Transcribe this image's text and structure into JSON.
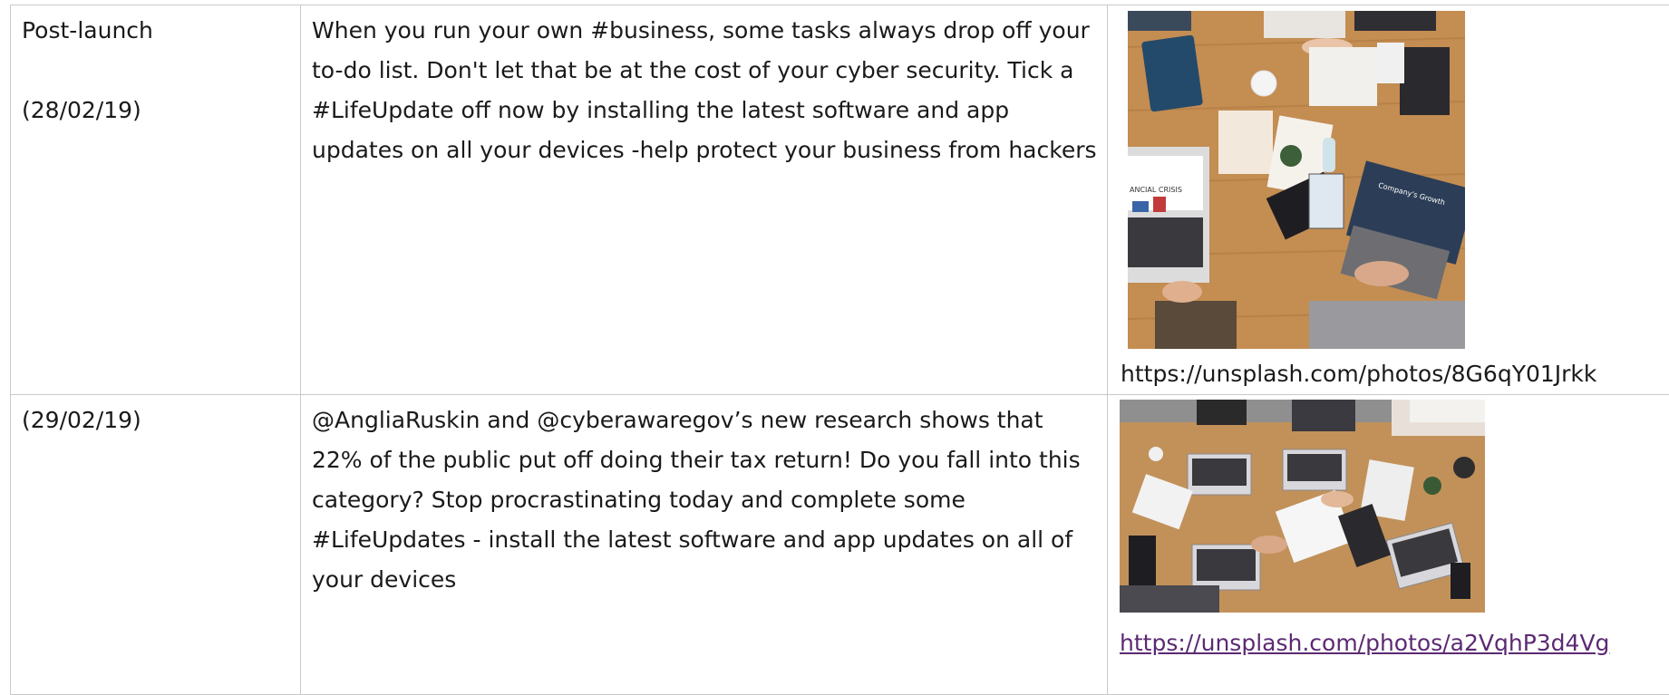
{
  "rows": [
    {
      "stage": "Post-launch",
      "date": "(28/02/19)",
      "post": "When you run your own #business, some tasks always drop off your to-do list. Don't let that be at the cost of your cyber security. Tick a #LifeUpdate off now by installing the latest software and app updates on all your devices -help protect your business from hackers",
      "image_alt": "Overhead view of a team working at a wooden desk with laptops and notebooks",
      "image_link": "https://unsplash.com/photos/8G6qY01Jrkk",
      "image_screen_text": [
        "ANCIAL CRISIS",
        "Company's Growth"
      ]
    },
    {
      "stage": "",
      "date": "(29/02/19)",
      "post": "@AngliaRuskin and @cyberawaregov’s new research shows that 22% of the public put off doing their tax return! Do you fall into this category? Stop procrastinating today and complete some #LifeUpdates - install the latest software and app updates on all of your devices",
      "image_alt": "Overhead view of people collaborating at a wooden table with several laptops and papers",
      "image_link": "https://unsplash.com/photos/a2VqhP3d4Vg"
    }
  ],
  "colors": {
    "border": "#c9c9c9",
    "text": "#1a1a1a",
    "visited_link": "#5c2a73",
    "desk_wood": "#c08a4f"
  }
}
